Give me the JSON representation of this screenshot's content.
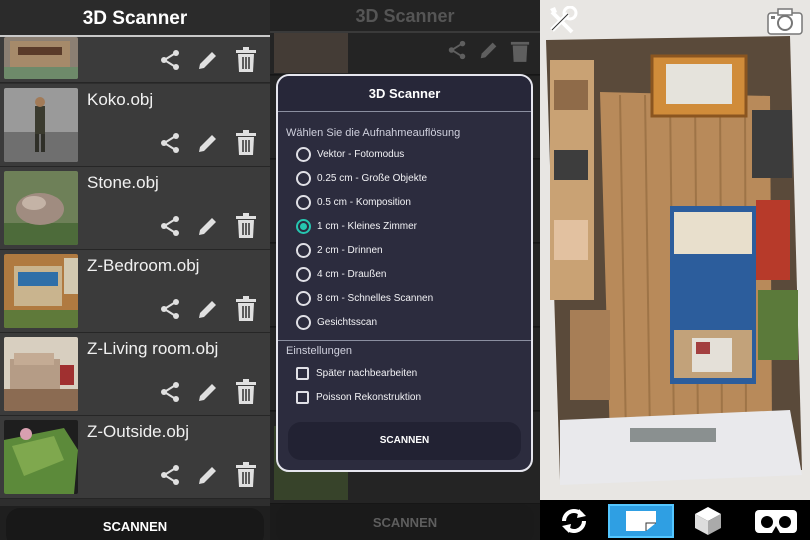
{
  "left_panel": {
    "title": "3D Scanner",
    "files": [
      {
        "name": ""
      },
      {
        "name": "Koko.obj"
      },
      {
        "name": "Stone.obj"
      },
      {
        "name": "Z-Bedroom.obj"
      },
      {
        "name": "Z-Living room.obj"
      },
      {
        "name": "Z-Outside.obj"
      }
    ],
    "scan_label": "SCANNEN",
    "icons": [
      "share-icon",
      "pencil-icon",
      "trash-icon"
    ]
  },
  "middle_panel": {
    "title": "3D Scanner",
    "scan_label": "SCANNEN",
    "dialog": {
      "title": "3D Scanner",
      "resolution_header": "Wählen Sie die Aufnahmeauflösung",
      "options": [
        {
          "label": "Vektor - Fotomodus",
          "selected": false
        },
        {
          "label": "0.25 cm - Große Objekte",
          "selected": false
        },
        {
          "label": "0.5 cm - Komposition",
          "selected": false
        },
        {
          "label": "1 cm - Kleines Zimmer",
          "selected": true
        },
        {
          "label": "2 cm - Drinnen",
          "selected": false
        },
        {
          "label": "4 cm - Draußen",
          "selected": false
        },
        {
          "label": "8 cm - Schnelles Scannen",
          "selected": false
        },
        {
          "label": "Gesichtsscan",
          "selected": false
        }
      ],
      "settings_header": "Einstellungen",
      "settings": [
        {
          "label": "Später nachbearbeiten",
          "checked": false
        },
        {
          "label": "Poisson Rekonstruktion",
          "checked": false
        }
      ],
      "scan_label": "SCANNEN"
    }
  },
  "right_panel": {
    "top_icons": [
      "tools-icon",
      "camera-icon"
    ],
    "toolbar": [
      "rotate-icon",
      "plane-view-icon",
      "cube-icon",
      "vr-headset-icon"
    ],
    "active_tool": "plane-view-icon",
    "accent": "#2f9fe3"
  },
  "colors": {
    "radio_accent": "#26c6b0",
    "dialog_bg": "#2c2c3e"
  }
}
